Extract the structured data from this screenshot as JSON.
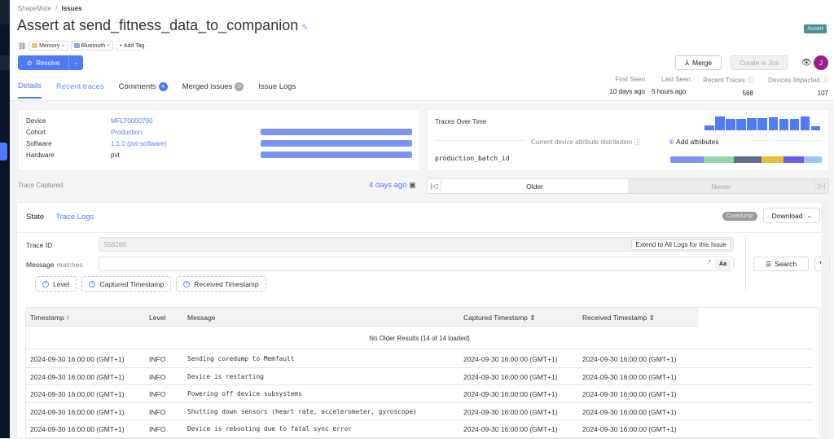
{
  "breadcrumb": {
    "org": "ShapeMate",
    "separator": "/",
    "page": "Issues"
  },
  "issue": {
    "title": "Assert at send_fitness_data_to_companion",
    "type_badge": "Assert",
    "tags": [
      {
        "label": "Memory",
        "color": "#e2c48c"
      },
      {
        "label": "Bluetooth",
        "color": "#8fa8d8"
      }
    ],
    "add_tag_label": "+ Add Tag"
  },
  "actions": {
    "resolve_label": "Resolve",
    "merge_label": "Merge",
    "jira_label": "Create in Jira",
    "avatar_initial": "J"
  },
  "tabs": [
    {
      "label": "Details",
      "active": true
    },
    {
      "label": "Recent traces"
    },
    {
      "label": "Comments",
      "badge": "4",
      "badge_color": "#4b7bf5"
    },
    {
      "label": "Merged issues",
      "badge": "0",
      "badge_color": "#aaaaaa"
    },
    {
      "label": "Issue Logs"
    }
  ],
  "stats": [
    {
      "label": "First Seen",
      "value": "10 days ago"
    },
    {
      "label": "Last Seen",
      "value": "5 hours ago"
    },
    {
      "label": "Recent Traces",
      "value": "568",
      "help": true
    },
    {
      "label": "Devices Impacted",
      "value": "107",
      "help": true
    }
  ],
  "device_info": [
    {
      "key": "Device",
      "value": "MFLT0000700",
      "link": true
    },
    {
      "key": "Cohort",
      "value": "Production",
      "link": true,
      "bar": 1.0
    },
    {
      "key": "Software",
      "value": "1.1.0 (pvt-software)",
      "link": true,
      "bar": 1.0
    },
    {
      "key": "Hardware",
      "value": "pvt",
      "link": false,
      "bar": 1.0
    }
  ],
  "traces_over_time": {
    "title": "Traces Over Time",
    "bars": [
      0.35,
      1.0,
      0.8,
      0.8,
      0.9,
      0.9,
      0.95,
      0.85,
      0.85,
      1.0,
      0.3
    ]
  },
  "attributes": {
    "divider_label": "Current device attribute distribution",
    "add_label": "Add attributes",
    "attribute_name": "production_batch_id",
    "segments": [
      {
        "share": 0.22,
        "color": "#7b93f5"
      },
      {
        "share": 0.2,
        "color": "#93d6a8"
      },
      {
        "share": 0.18,
        "color": "#646c8c"
      },
      {
        "share": 0.15,
        "color": "#e6bf35"
      },
      {
        "share": 0.13,
        "color": "#6a5cf0"
      },
      {
        "share": 0.12,
        "color": "#98c6ee"
      }
    ]
  },
  "trace": {
    "captured_label": "Trace Captured",
    "captured_ago": "4 days ago",
    "older_label": "Older",
    "newer_label": "Newer"
  },
  "panel": {
    "tabs": [
      {
        "label": "State"
      },
      {
        "label": "Trace Logs",
        "active": true
      }
    ],
    "coredump_badge": "Coredump",
    "download_label": "Download"
  },
  "filters": {
    "trace_id_label": "Trace ID",
    "trace_id_value": "558260",
    "extend_label": "Extend to All Logs for this Issue",
    "message_label": "Message",
    "message_op": "matches",
    "message_value": "",
    "regex_label": ".*",
    "case_label": "Aa",
    "search_label": "Search",
    "chips": [
      "Level",
      "Captured Timestamp",
      "Received Timestamp"
    ]
  },
  "logs": {
    "columns": [
      "Timestamp",
      "Level",
      "Message",
      "Captured Timestamp",
      "Received Timestamp"
    ],
    "sort_indicator": "↑",
    "no_older": "No Older Results (14 of 14 loaded)",
    "rows": [
      {
        "ts": "2024-09-30 16:00:00 (GMT+1)",
        "level": "INFO",
        "message": "Sending coredump to Memfault",
        "captured": "2024-09-30 16:00:00 (GMT+1)",
        "received": "2024-09-30 16:00:00 (GMT+1)"
      },
      {
        "ts": "2024-09-30 16:00:00 (GMT+1)",
        "level": "INFO",
        "message": "Device is restarting",
        "captured": "2024-09-30 16:00:00 (GMT+1)",
        "received": "2024-09-30 16:00:00 (GMT+1)"
      },
      {
        "ts": "2024-09-30 16:00:00 (GMT+1)",
        "level": "INFO",
        "message": "Powering off device subsystems",
        "captured": "2024-09-30 16:00:00 (GMT+1)",
        "received": "2024-09-30 16:00:00 (GMT+1)"
      },
      {
        "ts": "2024-09-30 16:00:00 (GMT+1)",
        "level": "INFO",
        "message": "Shutting down sensors (heart rate, accelerometer, gyroscope)",
        "captured": "2024-09-30 16:00:00 (GMT+1)",
        "received": "2024-09-30 16:00:00 (GMT+1)"
      },
      {
        "ts": "2024-09-30 16:00:00 (GMT+1)",
        "level": "INFO",
        "message": "Device is rebooting due to fatal sync error",
        "captured": "2024-09-30 16:00:00 (GMT+1)",
        "received": "2024-09-30 16:00:00 (GMT+1)"
      }
    ]
  }
}
